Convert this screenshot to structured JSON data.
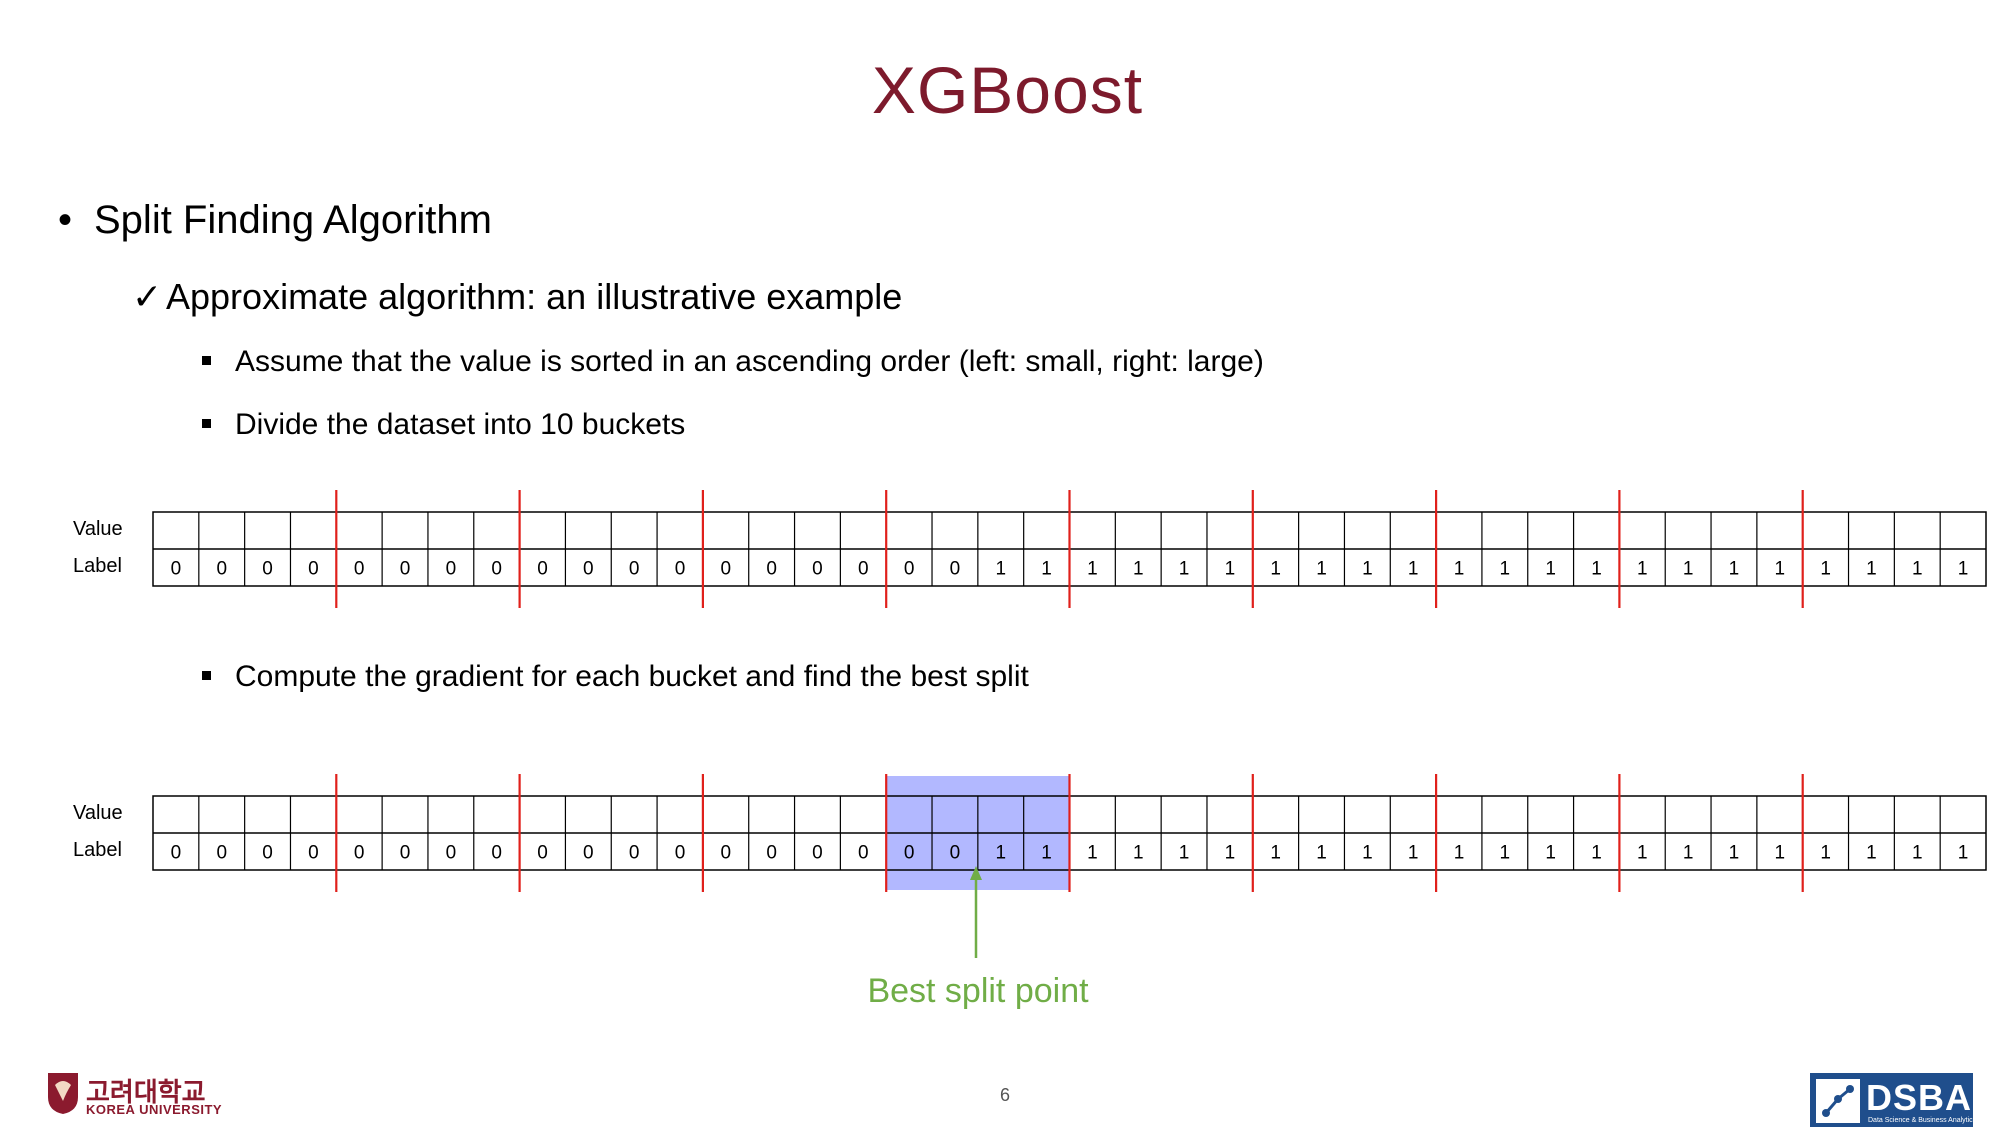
{
  "slide": {
    "title": "XGBoost",
    "bullet_main": "Split Finding Algorithm",
    "sub_bullet": "Approximate algorithm: an illustrative example",
    "points": [
      "Assume that the value is sorted in an ascending order (left: small, right: large)",
      "Divide the dataset into 10 buckets",
      "Compute the gradient for each bucket and find the best split"
    ],
    "row_value_label": "Value",
    "row_label_label": "Label",
    "labels": [
      "0",
      "0",
      "0",
      "0",
      "0",
      "0",
      "0",
      "0",
      "0",
      "0",
      "0",
      "0",
      "0",
      "0",
      "0",
      "0",
      "0",
      "0",
      "1",
      "1",
      "1",
      "1",
      "1",
      "1",
      "1",
      "1",
      "1",
      "1",
      "1",
      "1",
      "1",
      "1",
      "1",
      "1",
      "1",
      "1",
      "1",
      "1",
      "1",
      "1"
    ],
    "buckets": 10,
    "cells_per_bucket": 4,
    "highlight_bucket_index": 4,
    "best_split_label": "Best split point",
    "page_number": "6",
    "colors": {
      "title": "#7d1a2c",
      "divider": "#e0201b",
      "highlight": "#aab0ff",
      "arrow": "#70ad47"
    }
  },
  "footer": {
    "university_korean": "고려대학교",
    "university_english": "KOREA UNIVERSITY",
    "lab_logo": "DSBA",
    "lab_subtitle": "Data Science & Business Analytics"
  }
}
